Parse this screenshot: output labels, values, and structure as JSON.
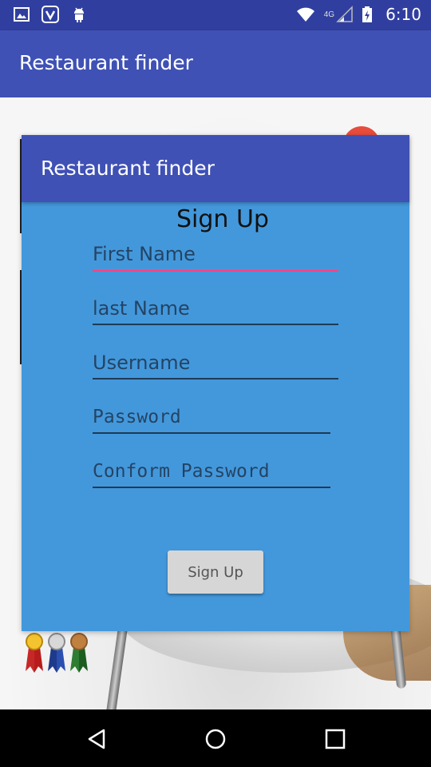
{
  "status_bar": {
    "time": "6:10",
    "network_label": "4G",
    "icons": [
      "gallery-icon",
      "saavn-icon",
      "android-icon",
      "wifi-icon",
      "signal-icon",
      "battery-charging-icon"
    ]
  },
  "app_bar": {
    "title": "Restaurant finder"
  },
  "dialog": {
    "title": "Restaurant finder",
    "form_title": "Sign Up",
    "fields": {
      "first_name": {
        "placeholder": "First Name",
        "value": ""
      },
      "last_name": {
        "placeholder": "last Name",
        "value": ""
      },
      "username": {
        "placeholder": "Username",
        "value": ""
      },
      "password": {
        "placeholder": "Password",
        "value": ""
      },
      "confirm_password": {
        "placeholder": "Conform Password",
        "value": ""
      }
    },
    "submit_label": "Sign Up"
  },
  "nav_bar": {
    "buttons": [
      "back-icon",
      "home-icon",
      "recents-icon"
    ]
  },
  "colors": {
    "status_bar": "#303f9f",
    "primary": "#3f51b5",
    "dialog_bg": "#4398db",
    "accent": "#ff4081",
    "button_bg": "#d6d6d6"
  }
}
